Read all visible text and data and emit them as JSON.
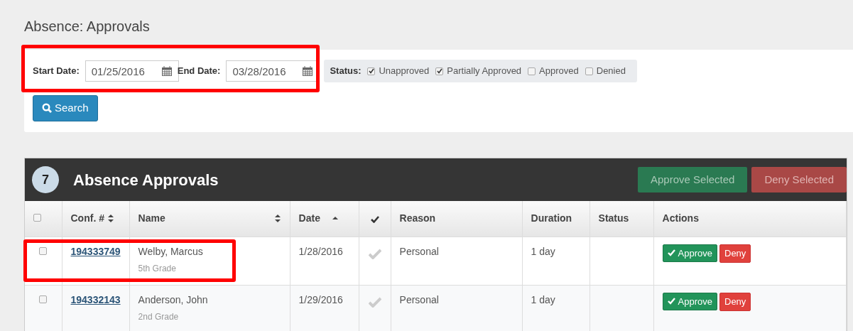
{
  "page_title": "Absence: Approvals",
  "filters": {
    "highlighted": true,
    "start_date": {
      "label": "Start Date:",
      "value": "01/25/2016"
    },
    "end_date": {
      "label": "End Date:",
      "value": "03/28/2016"
    },
    "status": {
      "label": "Status:",
      "options": [
        {
          "label": "Unapproved",
          "checked": true
        },
        {
          "label": "Partially Approved",
          "checked": true
        },
        {
          "label": "Approved",
          "checked": false
        },
        {
          "label": "Denied",
          "checked": false
        }
      ]
    },
    "search_button": "Search"
  },
  "panel": {
    "count": "7",
    "title": "Absence Approvals",
    "approve_selected": "Approve Selected",
    "deny_selected": "Deny Selected"
  },
  "table": {
    "columns": [
      {
        "kind": "checkbox",
        "selected": false
      },
      {
        "kind": "text",
        "label": "Conf. #",
        "sortable": true,
        "sorted_ascending": false
      },
      {
        "kind": "text",
        "label": "Name",
        "sortable": true,
        "sorted_ascending": false
      },
      {
        "kind": "text",
        "label": "Date",
        "sortable": true,
        "sorted_ascending": true
      },
      {
        "kind": "check"
      },
      {
        "kind": "text",
        "label": "Reason"
      },
      {
        "kind": "text",
        "label": "Duration"
      },
      {
        "kind": "text",
        "label": "Status"
      },
      {
        "kind": "text",
        "label": "Actions"
      }
    ],
    "rows": [
      {
        "selected": false,
        "highlighted": true,
        "conf": "194333749",
        "name": "Welby, Marcus",
        "grade": "5th Grade",
        "date": "1/28/2016",
        "confirmed": false,
        "reason": "Personal",
        "duration": "1 day",
        "approve": "Approve",
        "deny": "Deny"
      },
      {
        "selected": false,
        "highlighted": false,
        "conf": "194332143",
        "name": "Anderson, John",
        "grade": "2nd Grade",
        "date": "1/29/2016",
        "confirmed": false,
        "reason": "Personal",
        "duration": "1 day",
        "approve": "Approve",
        "deny": "Deny"
      }
    ]
  }
}
